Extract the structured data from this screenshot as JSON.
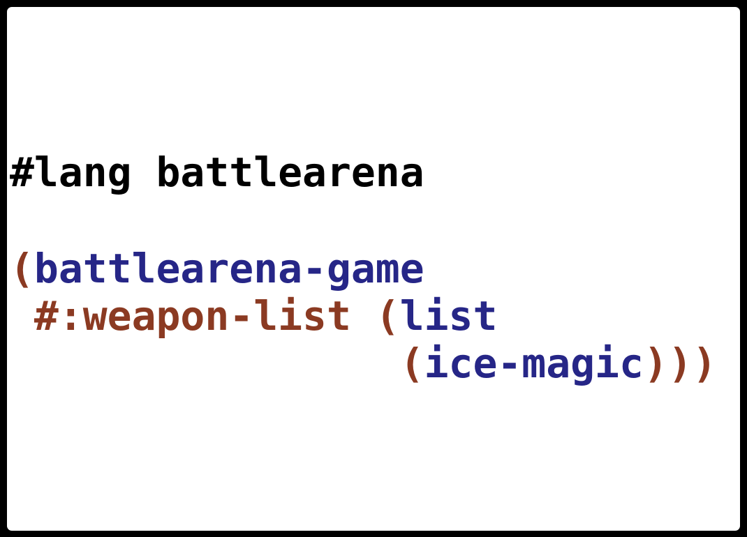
{
  "code": {
    "line1": {
      "text": "#lang battlearena"
    },
    "line2": {
      "open": "(",
      "ident": "battlearena-game"
    },
    "line3": {
      "indent": " ",
      "keyword": "#:weapon-list",
      "space": " ",
      "open": "(",
      "ident": "list"
    },
    "line4": {
      "indent": "                ",
      "open": "(",
      "ident": "ice-magic",
      "close": ")))"
    }
  },
  "colors": {
    "background": "#000000",
    "panel": "#ffffff",
    "plain": "#000000",
    "paren": "#8b3a22",
    "identifier": "#262687"
  }
}
